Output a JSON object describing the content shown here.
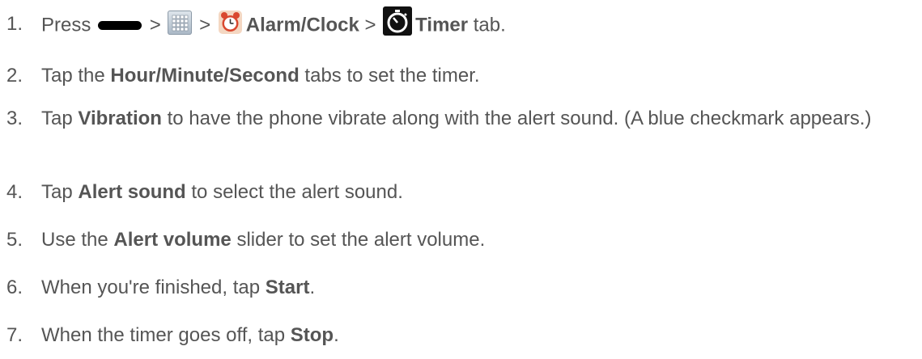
{
  "steps": [
    {
      "number": "1.",
      "press": "Press",
      "gt1": ">",
      "gt2": ">",
      "alarm_clock": "Alarm/Clock",
      "gt3": ">",
      "timer": "Timer",
      "tab": "tab.",
      "icons": [
        "home-key-icon",
        "apps-grid-icon",
        "alarm-clock-icon",
        "timer-icon"
      ]
    },
    {
      "number": "2.",
      "pre": "Tap the",
      "bold": "Hour/Minute/Second",
      "post": "tabs to set the timer."
    },
    {
      "number": "3.",
      "pre": "Tap",
      "bold": "Vibration",
      "post": "to have the phone vibrate along with the alert sound. (A blue checkmark appears.)"
    },
    {
      "number": "4.",
      "pre": "Tap",
      "bold": "Alert sound",
      "post": "to select the alert sound."
    },
    {
      "number": "5.",
      "pre": "Use the",
      "bold": "Alert volume",
      "post": "slider to set the alert volume."
    },
    {
      "number": "6.",
      "pre": "When you're finished, tap",
      "bold": "Start",
      "post": "."
    },
    {
      "number": "7.",
      "pre": "When the timer goes off, tap",
      "bold": "Stop",
      "post": "."
    }
  ]
}
